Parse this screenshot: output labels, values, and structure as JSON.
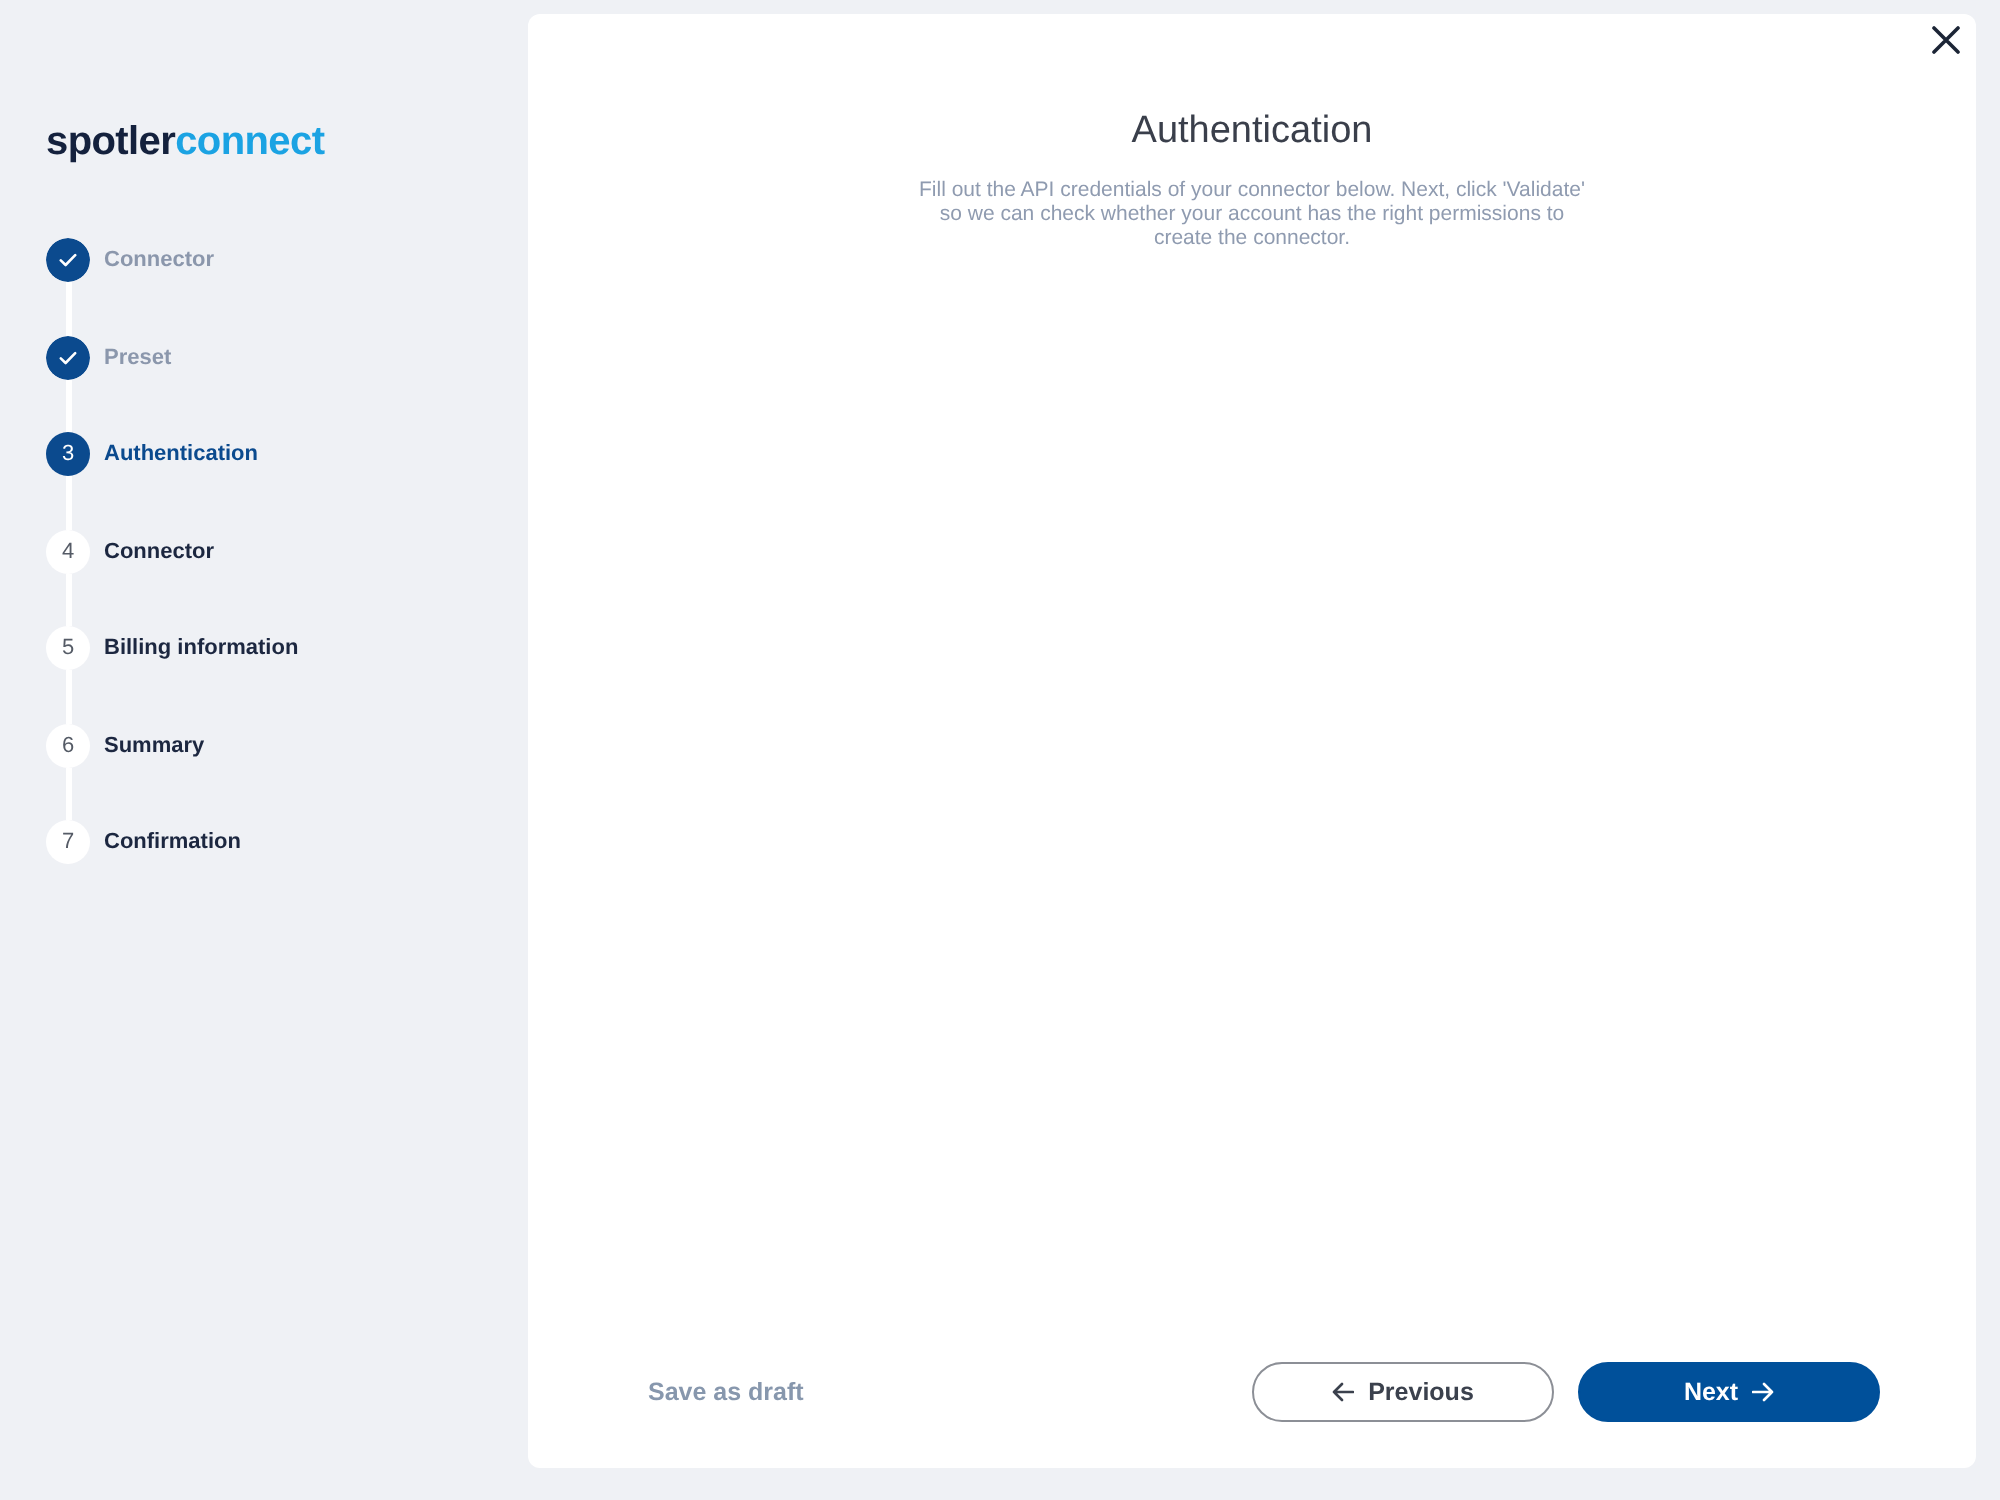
{
  "logo": {
    "dark_part": "spotler",
    "light_part": "connect"
  },
  "steps": [
    {
      "label": "Connector",
      "completed": true,
      "selected": false
    },
    {
      "label": "Preset",
      "completed": true,
      "selected": false
    },
    {
      "number": "3",
      "label": "Authentication",
      "completed": false,
      "selected": true
    },
    {
      "number": "4",
      "label": "Connector",
      "completed": false,
      "selected": false
    },
    {
      "number": "5",
      "label": "Billing information",
      "completed": false,
      "selected": false
    },
    {
      "number": "6",
      "label": "Summary",
      "completed": false,
      "selected": false
    },
    {
      "number": "7",
      "label": "Confirmation",
      "completed": false,
      "selected": false
    }
  ],
  "panel": {
    "title": "Authentication",
    "description": "Fill out the API credentials of your connector below. Next, click 'Validate' so we can check whether your account has the right permissions to create the connector."
  },
  "footer": {
    "save_draft": "Save as draft",
    "buttons": [
      {
        "label": "Previous",
        "kind": "secondary"
      },
      {
        "label": "Next",
        "kind": "primary"
      }
    ]
  }
}
